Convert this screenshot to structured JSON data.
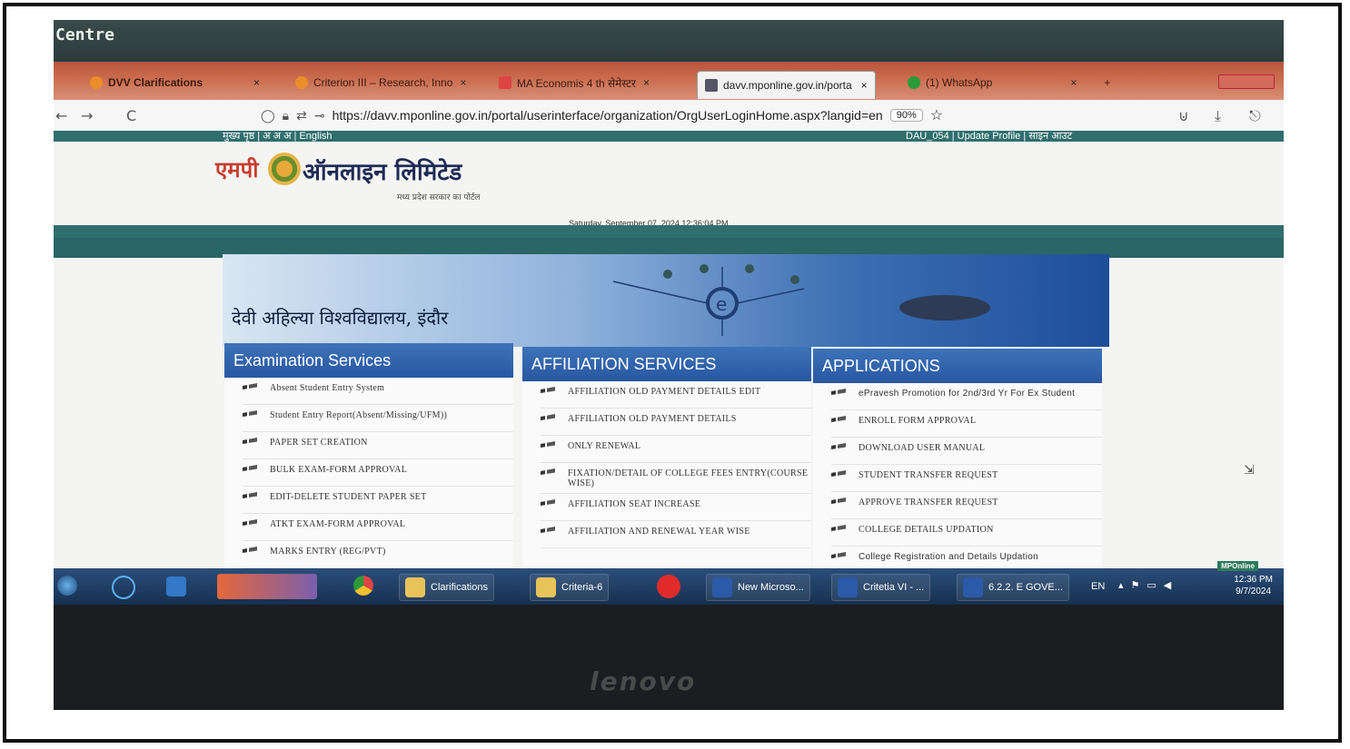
{
  "app_title": "Centre",
  "browser": {
    "tabs": [
      {
        "label": "DVV Clarifications",
        "close": "×"
      },
      {
        "label": "Criterion III – Research, Inno",
        "close": "×"
      },
      {
        "label": "MA Economis 4 th सेमेस्टर",
        "close": "×"
      },
      {
        "label": "davv.mponline.gov.in/porta",
        "close": "×",
        "active": true
      },
      {
        "label": "(1) WhatsApp",
        "close": "×"
      }
    ],
    "new_tab": "+",
    "back": "←",
    "forward": "→",
    "reload": "C",
    "url": "https://davv.mponline.gov.in/portal/userinterface/organization/OrgUserLoginHome.aspx?langid=en",
    "zoom": "90%"
  },
  "page": {
    "top_left_links": "मुख्य पृष्ठ | अ  अ  अ | English",
    "top_right_links": "DAU_054 | Update Profile | साइन आउट",
    "logo_mp": "एमपी",
    "logo_name": "ऑनलाइन लिमिटेड",
    "logo_sub": "मध्य प्रदेश सरकार का पोर्टल",
    "datetime": "Saturday, September 07, 2024 12:36:04 PM",
    "banner_title": "देवी अहिल्या विश्वविद्यालय, इंदौर",
    "columns": [
      {
        "heading": "Examination Services",
        "items": [
          "Absent Student Entry System",
          "Student Entry Report(Absent/Missing/UFM))",
          "PAPER SET CREATION",
          "BULK EXAM-FORM APPROVAL",
          "EDIT-DELETE STUDENT PAPER SET",
          "ATKT EXAM-FORM APPROVAL",
          "MARKS ENTRY (REG/PVT)"
        ]
      },
      {
        "heading": "AFFILIATION SERVICES",
        "items": [
          "AFFILIATION OLD PAYMENT DETAILS EDIT",
          "AFFILIATION OLD PAYMENT DETAILS",
          "ONLY RENEWAL",
          "FIXATION/DETAIL OF COLLEGE FEES ENTRY(COURSE WISE)",
          "AFFILIATION SEAT INCREASE",
          "AFFILIATION AND RENEWAL YEAR WISE"
        ]
      },
      {
        "heading": "APPLICATIONS",
        "items": [
          "ePravesh Promotion for 2nd/3rd Yr For Ex Student",
          "ENROLL FORM APPROVAL",
          "DOWNLOAD USER MANUAL",
          "STUDENT TRANSFER REQUEST",
          "APPROVE TRANSFER REQUEST",
          "COLLEGE DETAILS UPDATION",
          "College Registration and Details Updation"
        ]
      }
    ]
  },
  "taskbar": {
    "items": [
      "Clarifications",
      "Criteria-6",
      "New Microso...",
      "Critetia VI - ...",
      "6.2.2. E GOVE..."
    ],
    "lang": "EN",
    "badge": "MPOnline",
    "time": "12:36 PM",
    "date": "9/7/2024"
  },
  "bezel_logo": "lenovo",
  "colors": {
    "header_blue": "#2857a1",
    "teal_band": "#2f6f6e",
    "tab_strip": "#c96a4c",
    "taskbar": "#16304f"
  }
}
